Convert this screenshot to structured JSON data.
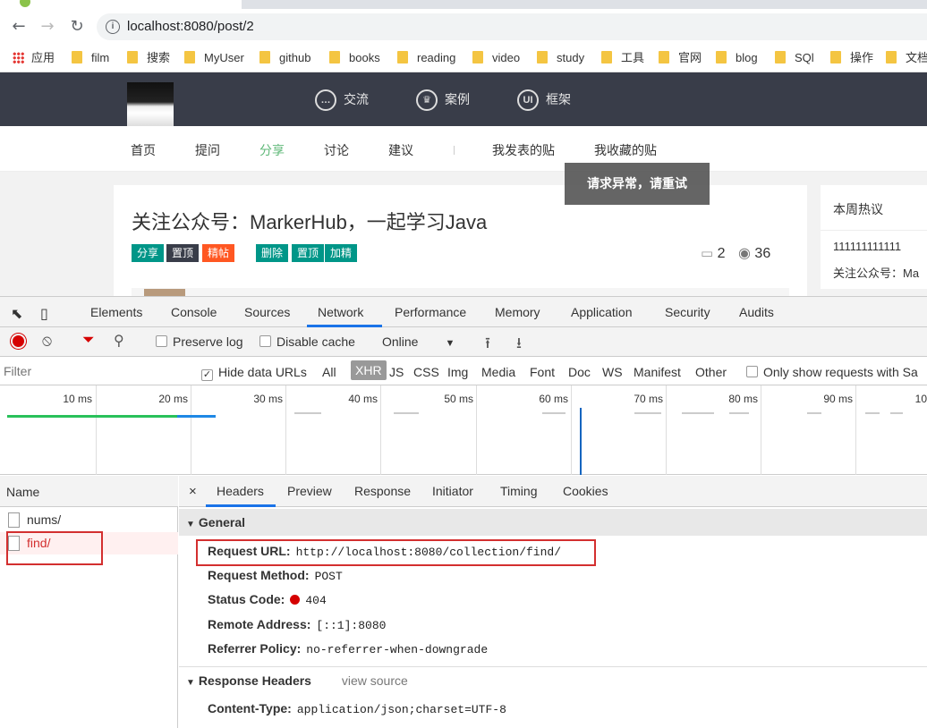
{
  "browser": {
    "url": "localhost:8080/post/2",
    "bookmarks": [
      "应用",
      "film",
      "搜索",
      "MyUser",
      "github",
      "books",
      "reading",
      "video",
      "study",
      "工具",
      "官网",
      "blog",
      "SQl",
      "操作",
      "文档"
    ]
  },
  "site": {
    "top_nav": [
      {
        "icon": "chat-icon",
        "label": "交流"
      },
      {
        "icon": "crown-icon",
        "label": "案例"
      },
      {
        "icon": "ui-icon",
        "label": "框架"
      }
    ],
    "sub_nav": [
      "首页",
      "提问",
      "分享",
      "讨论",
      "建议",
      "我发表的贴",
      "我收藏的贴"
    ],
    "active_sub_nav": "分享",
    "toast": "请求异常，请重试",
    "post": {
      "title": "关注公众号：MarkerHub，一起学习Java",
      "badges": [
        {
          "label": "分享",
          "color": "#009688"
        },
        {
          "label": "置顶",
          "color": "#393d49"
        },
        {
          "label": "精帖",
          "color": "#ff5722"
        },
        {
          "label": "删除",
          "color": "#009688"
        },
        {
          "label": "置顶",
          "color": "#009688"
        },
        {
          "label": "加精",
          "color": "#009688"
        }
      ],
      "comments": "2",
      "views": "36"
    },
    "sidebar": {
      "title": "本周热议",
      "items": [
        "111111111111",
        "关注公众号：Ma"
      ]
    }
  },
  "devtools": {
    "tabs": [
      "Elements",
      "Console",
      "Sources",
      "Network",
      "Performance",
      "Memory",
      "Application",
      "Security",
      "Audits"
    ],
    "active_tab": "Network",
    "toolbar": {
      "preserve_log": "Preserve log",
      "disable_cache": "Disable cache",
      "throttle": "Online"
    },
    "filter": {
      "placeholder": "Filter",
      "hide_data_urls": "Hide data URLs",
      "types": [
        "All",
        "XHR",
        "JS",
        "CSS",
        "Img",
        "Media",
        "Font",
        "Doc",
        "WS",
        "Manifest",
        "Other"
      ],
      "selected_type": "XHR",
      "only_show": "Only show requests with Sa"
    },
    "timeline_ticks": [
      "10 ms",
      "20 ms",
      "30 ms",
      "40 ms",
      "50 ms",
      "60 ms",
      "70 ms",
      "80 ms",
      "90 ms",
      "10"
    ],
    "requests": {
      "header": "Name",
      "rows": [
        "nums/",
        "find/"
      ]
    },
    "detail": {
      "tabs": [
        "Headers",
        "Preview",
        "Response",
        "Initiator",
        "Timing",
        "Cookies"
      ],
      "active_tab": "Headers",
      "general_title": "General",
      "general": [
        {
          "key": "Request URL:",
          "value": "http://localhost:8080/collection/find/"
        },
        {
          "key": "Request Method:",
          "value": "POST"
        },
        {
          "key": "Status Code:",
          "value": "404"
        },
        {
          "key": "Remote Address:",
          "value": "[::1]:8080"
        },
        {
          "key": "Referrer Policy:",
          "value": "no-referrer-when-downgrade"
        }
      ],
      "response_headers_title": "Response Headers",
      "view_source": "view source",
      "response_headers": [
        {
          "key": "Content-Type:",
          "value": "application/json;charset=UTF-8"
        }
      ]
    }
  }
}
